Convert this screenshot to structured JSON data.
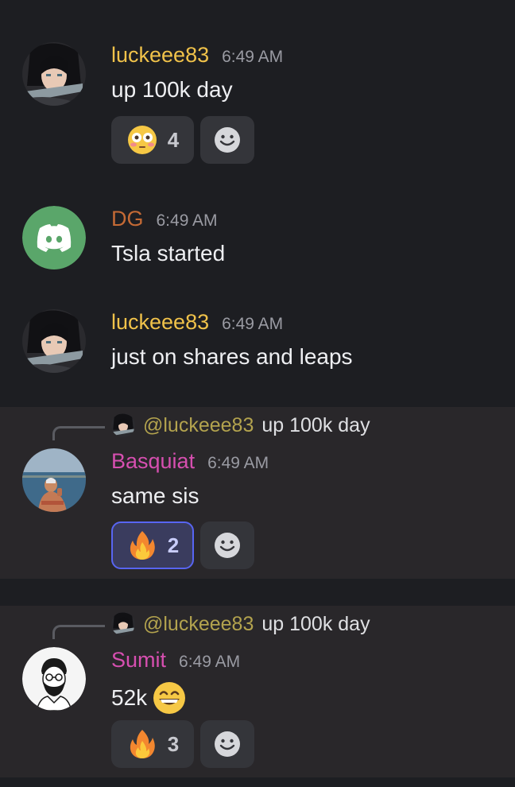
{
  "messages": [
    {
      "username": "luckeee83",
      "username_color": "#f0c24a",
      "time": "6:49 AM",
      "content": "up 100k day",
      "avatar": "anime-character-avatar",
      "reactions": [
        {
          "emoji": "flushed-face-emoji",
          "count": "4"
        }
      ]
    },
    {
      "username": "DG",
      "username_color": "#c46a35",
      "time": "6:49 AM",
      "content": "Tsla started",
      "avatar": "discord-logo-avatar"
    },
    {
      "username": "luckeee83",
      "username_color": "#f0c24a",
      "time": "6:49 AM",
      "content": "just on shares and leaps",
      "avatar": "anime-character-avatar"
    },
    {
      "reply_to": {
        "mention": "@luckeee83",
        "text": "up 100k day"
      },
      "username": "Basquiat",
      "username_color": "#d64fb0",
      "time": "6:49 AM",
      "content": "same sis",
      "avatar": "beach-photo-avatar",
      "reactions": [
        {
          "emoji": "fire-emoji",
          "count": "2",
          "active": true
        }
      ]
    },
    {
      "reply_to": {
        "mention": "@luckeee83",
        "text": "up 100k day"
      },
      "username": "Sumit",
      "username_color": "#d64fb0",
      "time": "6:49 AM",
      "content": "52k",
      "content_emoji": "grinning-face-emoji",
      "avatar": "bearded-man-sketch-avatar",
      "reactions": [
        {
          "emoji": "fire-emoji",
          "count": "3"
        }
      ]
    }
  ],
  "add_reaction_icon": "smiley-add-reaction-icon",
  "colors": {
    "background": "#1d1e22",
    "highlight_background": "#29272a",
    "reaction_bg": "#34353a",
    "reaction_active_border": "#5865f2",
    "mention": "#b3a34e",
    "discord_green": "#5aa66a"
  }
}
